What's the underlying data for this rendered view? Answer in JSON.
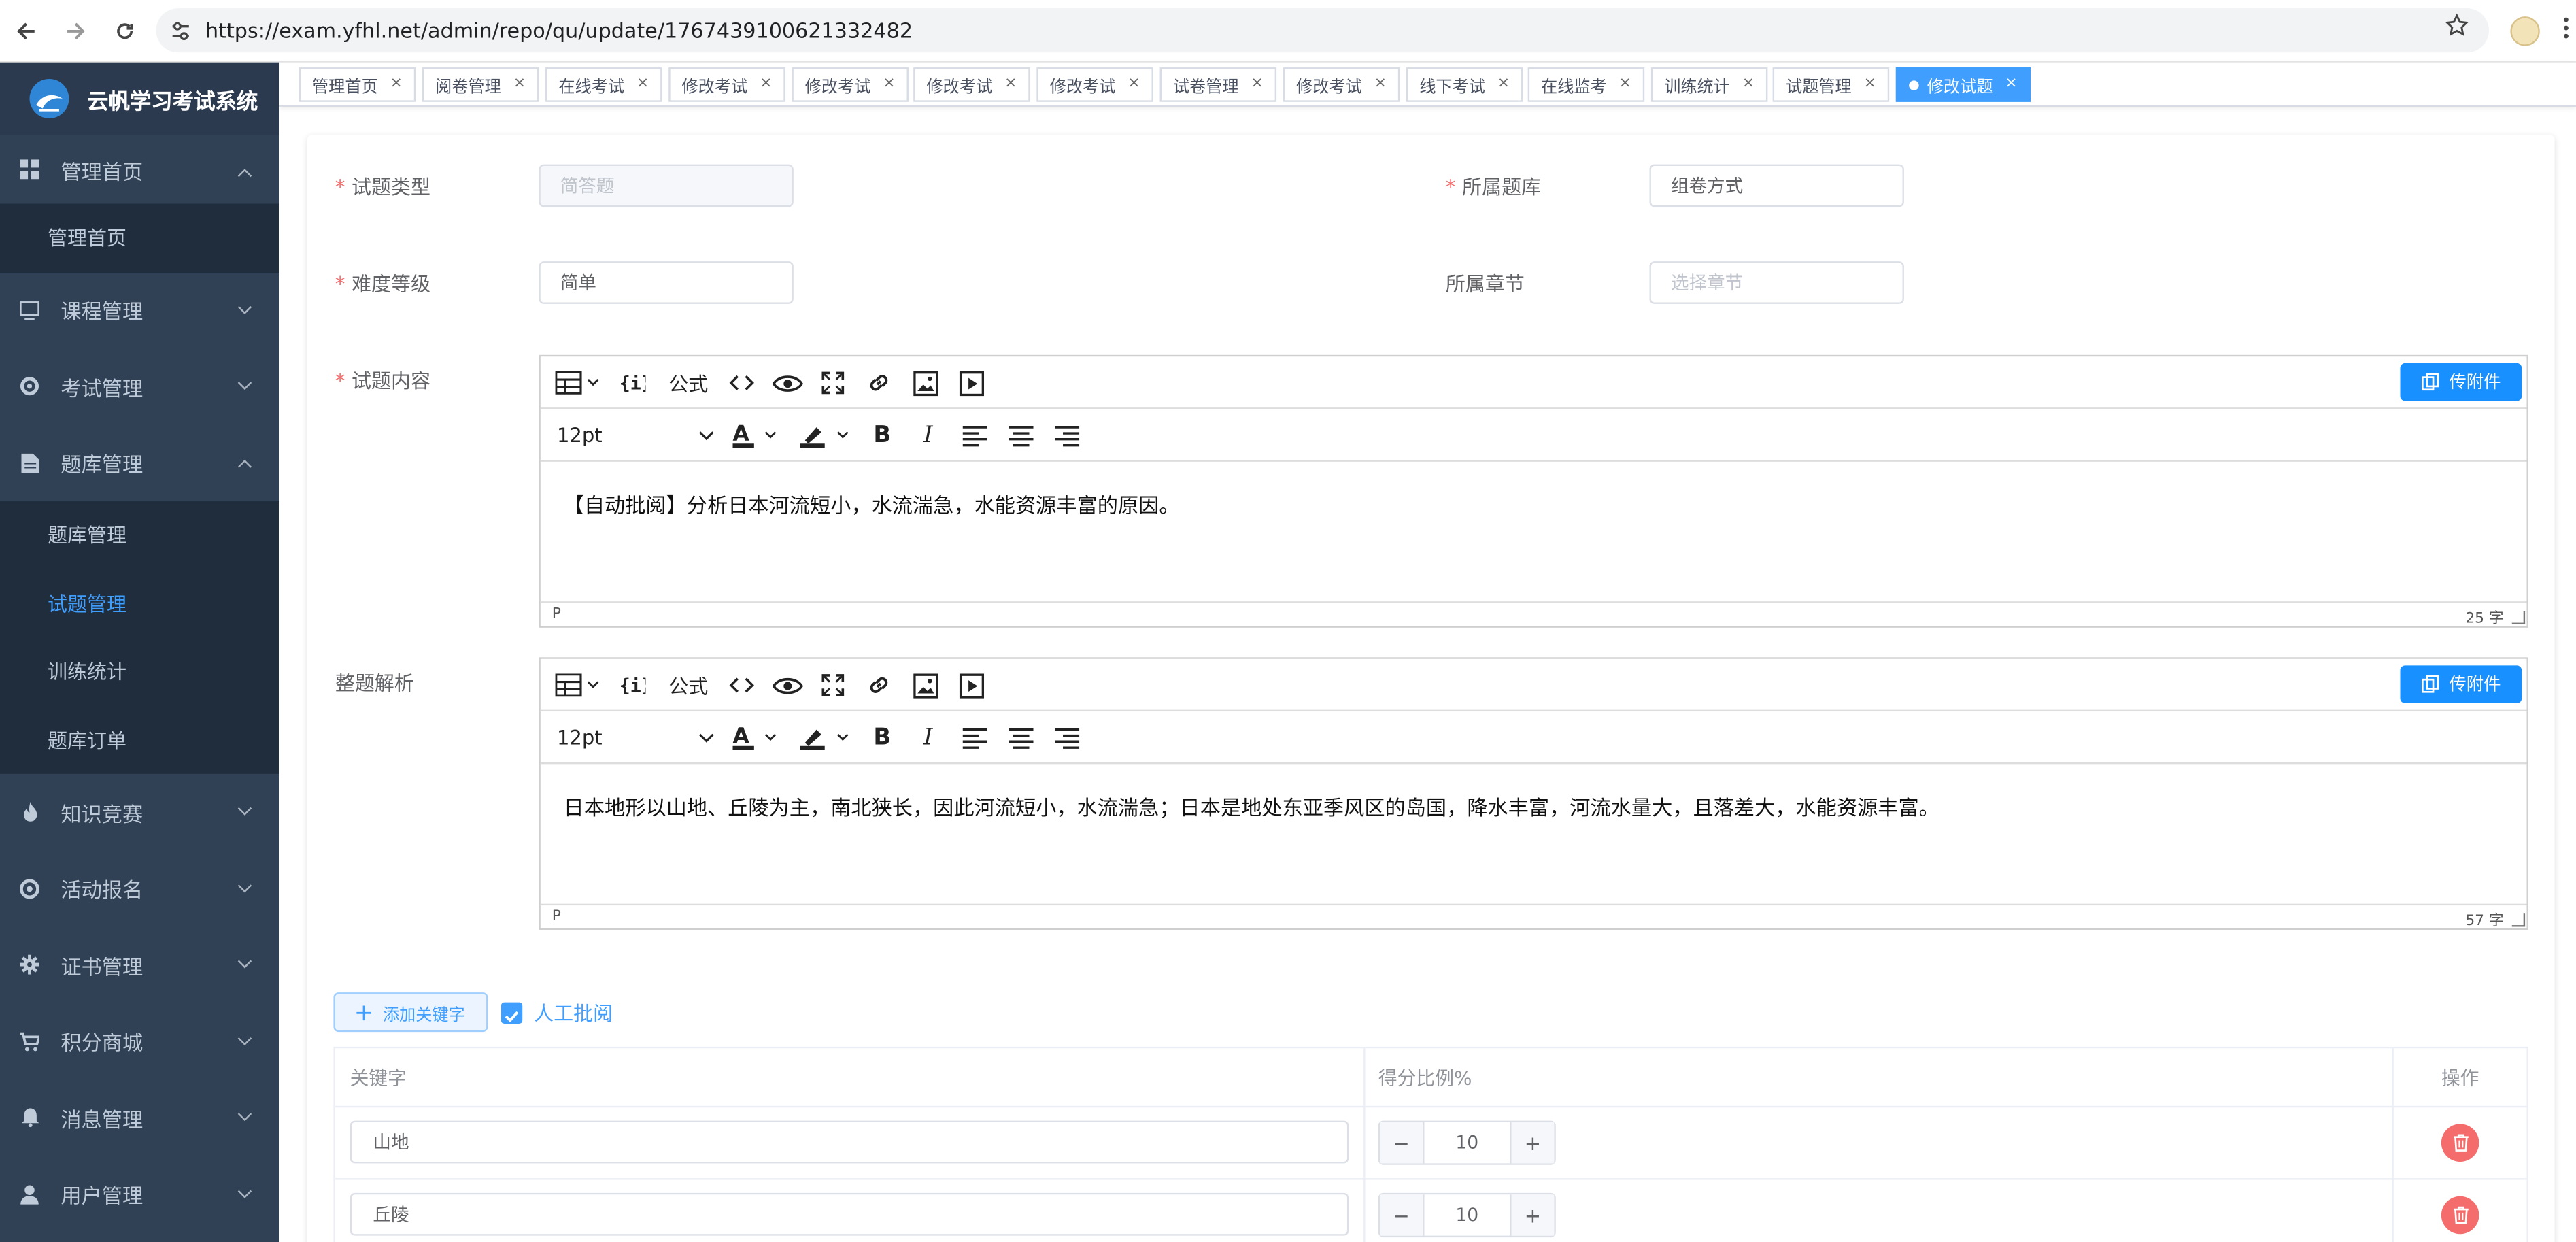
{
  "browser": {
    "url": "https://exam.yfhl.net/admin/repo/qu/update/1767439100621332482"
  },
  "sidebar": {
    "brand": "云帆学习考试系统",
    "menus": [
      {
        "label": "管理首页",
        "icon": "dashboard-icon",
        "expanded": true,
        "children": [
          {
            "label": "管理首页",
            "active": false
          }
        ]
      },
      {
        "label": "课程管理",
        "icon": "monitor-icon",
        "expanded": false
      },
      {
        "label": "考试管理",
        "icon": "gear-icon",
        "expanded": false
      },
      {
        "label": "题库管理",
        "icon": "document-icon",
        "expanded": true,
        "children": [
          {
            "label": "题库管理",
            "active": false
          },
          {
            "label": "试题管理",
            "active": true
          },
          {
            "label": "训练统计",
            "active": false
          },
          {
            "label": "题库订单",
            "active": false
          }
        ]
      },
      {
        "label": "知识竞赛",
        "icon": "fire-icon",
        "expanded": false
      },
      {
        "label": "活动报名",
        "icon": "circle-icon",
        "expanded": false
      },
      {
        "label": "证书管理",
        "icon": "cog-icon",
        "expanded": false
      },
      {
        "label": "积分商城",
        "icon": "cart-icon",
        "expanded": false
      },
      {
        "label": "消息管理",
        "icon": "bell-icon",
        "expanded": false
      },
      {
        "label": "用户管理",
        "icon": "user-icon",
        "expanded": false
      }
    ]
  },
  "tags": [
    {
      "label": "管理首页",
      "active": false
    },
    {
      "label": "阅卷管理",
      "active": false
    },
    {
      "label": "在线考试",
      "active": false
    },
    {
      "label": "修改考试",
      "active": false
    },
    {
      "label": "修改考试",
      "active": false
    },
    {
      "label": "修改考试",
      "active": false
    },
    {
      "label": "修改考试",
      "active": false
    },
    {
      "label": "试卷管理",
      "active": false
    },
    {
      "label": "修改考试",
      "active": false
    },
    {
      "label": "线下考试",
      "active": false
    },
    {
      "label": "在线监考",
      "active": false
    },
    {
      "label": "训练统计",
      "active": false
    },
    {
      "label": "试题管理",
      "active": false
    },
    {
      "label": "修改试题",
      "active": true
    }
  ],
  "form": {
    "qu_type_label": "试题类型",
    "qu_type_value": "简答题",
    "repo_label": "所属题库",
    "repo_value": "组卷方式",
    "level_label": "难度等级",
    "level_value": "简单",
    "chapter_label": "所属章节",
    "chapter_placeholder": "选择章节",
    "content_label": "试题内容",
    "analysis_label": "整题解析"
  },
  "editor_toolbar": {
    "formula": "公式",
    "font_size": "12pt",
    "upload": "传附件"
  },
  "content_editor": {
    "text": "【自动批阅】分析日本河流短小，水流湍急，水能资源丰富的原因。",
    "path": "P",
    "count": "25 字"
  },
  "analysis_editor": {
    "text": "日本地形以山地、丘陵为主，南北狭长，因此河流短小，水流湍急；日本是地处东亚季风区的岛国，降水丰富，河流水量大，且落差大，水能资源丰富。",
    "path": "P",
    "count": "57 字"
  },
  "keywords": {
    "add_button": "添加关键字",
    "manual_check_label": "人工批阅",
    "manual_checked": true,
    "headers": {
      "keyword": "关键字",
      "ratio": "得分比例%",
      "action": "操作"
    },
    "rows": [
      {
        "keyword": "山地",
        "ratio": "10"
      },
      {
        "keyword": "丘陵",
        "ratio": "10"
      }
    ]
  },
  "colors": {
    "sidebar_bg": "#304156",
    "accent": "#409eff",
    "danger": "#f56c6c",
    "editor_button": "#1890ff"
  }
}
